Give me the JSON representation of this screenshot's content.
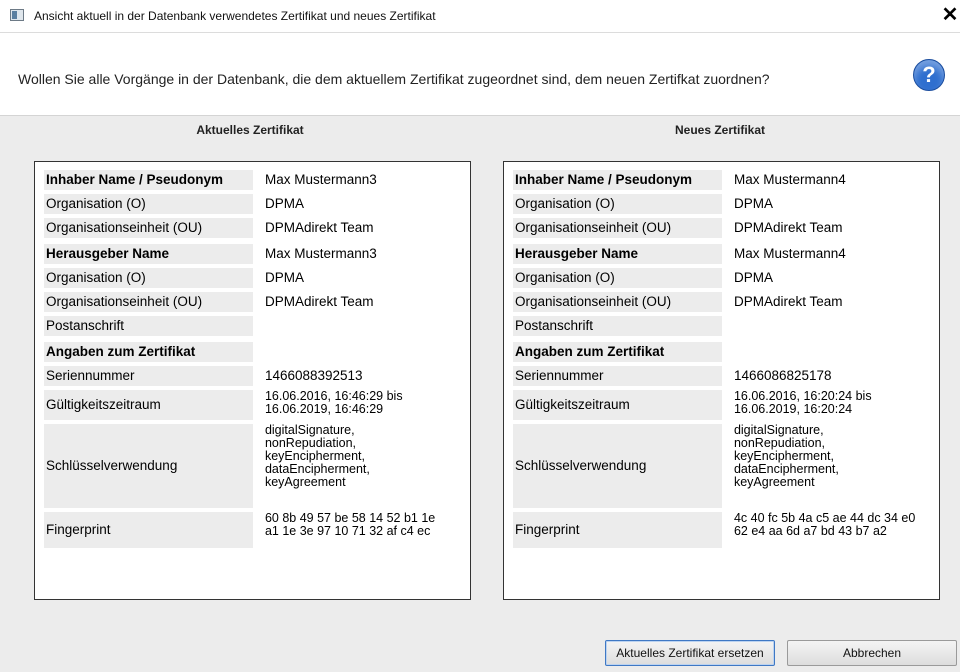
{
  "window": {
    "title": "Ansicht aktuell in der Datenbank verwendetes Zertifikat und neues Zertifikat",
    "close_label": "✕"
  },
  "header": {
    "question": "Wollen Sie alle Vorgänge in der Datenbank, die dem aktuellem Zertifikat zugeordnet sind, dem neuen Zertifkat zuordnen?",
    "help_glyph": "?"
  },
  "labels": {
    "inhaber": "Inhaber Name / Pseudonym",
    "org": "Organisation (O)",
    "orgunit": "Organisationseinheit (OU)",
    "herausgeber": "Herausgeber Name",
    "postanschrift": "Postanschrift",
    "angaben": "Angaben zum Zertifikat",
    "seriennummer": "Seriennummer",
    "gueltigkeit": "Gültigkeitszeitraum",
    "schluessel": "Schlüsselverwendung",
    "fingerprint": "Fingerprint"
  },
  "current": {
    "heading": "Aktuelles Zertifikat",
    "inhaber_name": "Max Mustermann3",
    "inhaber_org": "DPMA",
    "inhaber_ou": "DPMAdirekt Team",
    "herausgeber_name": "Max Mustermann3",
    "herausgeber_org": "DPMA",
    "herausgeber_ou": "DPMAdirekt Team",
    "postanschrift": "",
    "seriennummer": "1466088392513",
    "gueltig_l1": "16.06.2016, 16:46:29 bis",
    "gueltig_l2": "16.06.2019, 16:46:29",
    "key_usage": [
      "digitalSignature,",
      "nonRepudiation,",
      "keyEncipherment,",
      "dataEncipherment,",
      "keyAgreement"
    ],
    "fp_l1": "60 8b 49 57 be 58 14 52 b1 1e",
    "fp_l2": "a1 1e 3e 97 10 71 32 af c4 ec"
  },
  "new": {
    "heading": "Neues Zertifikat",
    "inhaber_name": "Max Mustermann4",
    "inhaber_org": "DPMA",
    "inhaber_ou": "DPMAdirekt Team",
    "herausgeber_name": "Max Mustermann4",
    "herausgeber_org": "DPMA",
    "herausgeber_ou": "DPMAdirekt Team",
    "postanschrift": "",
    "seriennummer": "1466086825178",
    "gueltig_l1": "16.06.2016, 16:20:24 bis",
    "gueltig_l2": "16.06.2019, 16:20:24",
    "key_usage": [
      "digitalSignature,",
      "nonRepudiation,",
      "keyEncipherment,",
      "dataEncipherment,",
      "keyAgreement"
    ],
    "fp_l1": "4c 40 fc 5b 4a c5 ae 44 dc 34 e0",
    "fp_l2": "62 e4 aa 6d a7 bd 43 b7 a2"
  },
  "buttons": {
    "replace": "Aktuelles Zertifikat ersetzen",
    "cancel": "Abbrechen"
  }
}
